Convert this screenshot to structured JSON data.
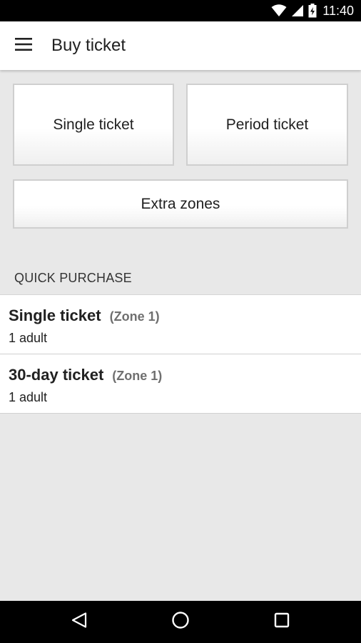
{
  "status_bar": {
    "time": "11:40",
    "icons": [
      "wifi-icon",
      "cell-signal-icon",
      "battery-charging-icon"
    ]
  },
  "app_bar": {
    "menu_icon": "hamburger-menu-icon",
    "title": "Buy ticket"
  },
  "ticket_types": {
    "single": "Single ticket",
    "period": "Period ticket",
    "extra_zones": "Extra zones"
  },
  "quick_purchase": {
    "header": "QUICK PURCHASE",
    "items": [
      {
        "name": "Single ticket",
        "zone": "(Zone 1)",
        "passengers": "1 adult"
      },
      {
        "name": "30-day ticket",
        "zone": "(Zone 1)",
        "passengers": "1 adult"
      }
    ]
  },
  "nav_bar": {
    "icons": [
      "back-icon",
      "home-icon",
      "recents-icon"
    ]
  },
  "colors": {
    "background": "#e8e8e8",
    "surface": "#ffffff",
    "zone_text": "#6f6f6f",
    "system_bars": "#000000"
  }
}
